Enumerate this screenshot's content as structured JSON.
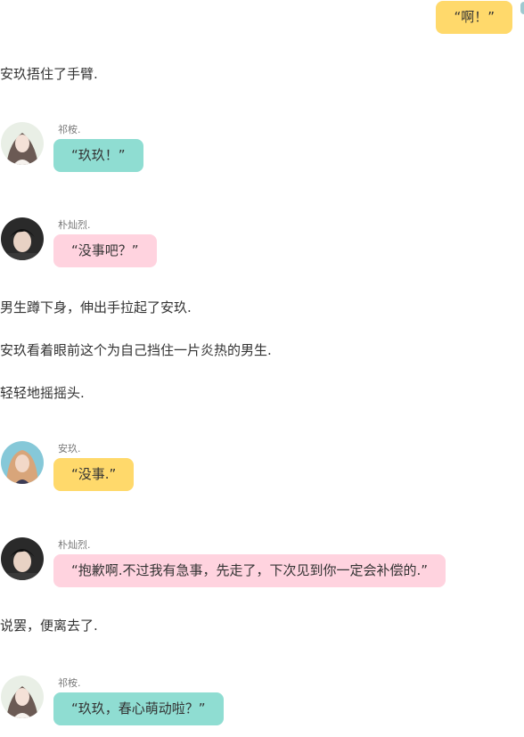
{
  "top_message": {
    "text": "“啊！”"
  },
  "narration": [
    "安玖捂住了手臂.",
    "男生蹲下身，伸出手拉起了安玖.",
    "安玖看着眼前这个为自己挡住一片炎热的男生.",
    "轻轻地摇摇头.",
    "说罢，便离去了."
  ],
  "messages": [
    {
      "sender": "祁桉.",
      "text": "“玖玖！”",
      "color": "#8fddd2"
    },
    {
      "sender": "朴灿烈.",
      "text": "“没事吧？”",
      "color": "#ffd3df"
    },
    {
      "sender": "安玖.",
      "text": "“没事.”",
      "color": "#ffd96b"
    },
    {
      "sender": "朴灿烈.",
      "text": "“抱歉啊.不过我有急事，先走了，下次见到你一定会补偿的.”",
      "color": "#ffd3df"
    },
    {
      "sender": "祁桉.",
      "text": "“玖玖，春心萌动啦？”",
      "color": "#8fddd2"
    }
  ]
}
